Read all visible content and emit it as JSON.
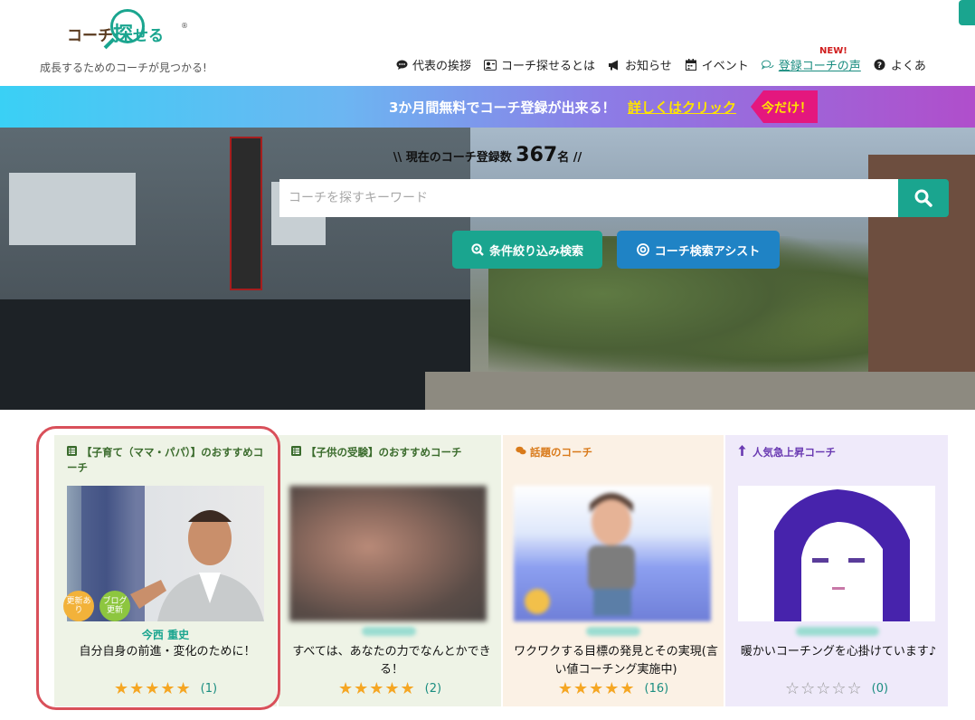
{
  "header": {
    "logo_left": "コーチ",
    "logo_mid": "探",
    "logo_end": "せる",
    "logo_reg": "®",
    "tagline": "成長するためのコーチが見つかる!",
    "new_badge": "NEW!",
    "nav": [
      {
        "label": "代表の挨拶",
        "icon": "chat-bubble-icon"
      },
      {
        "label": "コーチ探せるとは",
        "icon": "person-card-icon"
      },
      {
        "label": "お知らせ",
        "icon": "megaphone-icon"
      },
      {
        "label": "イベント",
        "icon": "calendar-icon"
      },
      {
        "label": "登録コーチの声",
        "icon": "comments-icon"
      },
      {
        "label": "よくあ",
        "icon": "question-circle-icon"
      }
    ]
  },
  "banner": {
    "text": "3か月間無料でコーチ登録が出来る！",
    "link": "詳しくはクリック",
    "tag": "今だけ！"
  },
  "hero": {
    "count_prefix": "\\\\ 現在のコーチ登録数",
    "count": "367",
    "count_suffix": "名 //",
    "search_placeholder": "コーチを探すキーワード",
    "filter_button": "条件絞り込み検索",
    "assist_button": "コーチ検索アシスト"
  },
  "cards": [
    {
      "title": "【子育て（ママ・パパ）】のおすすめコーチ",
      "name": "今西 重史",
      "desc": "自分自身の前進・変化のために！",
      "stars": "★★★★★",
      "count": "(1)",
      "badge1": "更新あり",
      "badge2": "ブログ更新"
    },
    {
      "title": "【子供の受験】のおすすめコーチ",
      "desc": "すべては、あなたの力でなんとかできる！",
      "stars": "★★★★★",
      "count": "(2)"
    },
    {
      "title": "話題のコーチ",
      "desc": "ワクワクする目標の発見とその実現(言い値コーチング実施中)",
      "stars": "★★★★★",
      "count": "(16)"
    },
    {
      "title": "人気急上昇コーチ",
      "desc": "暖かいコーチングを心掛けています♪",
      "stars": "☆☆☆☆☆",
      "count": "(0)"
    }
  ],
  "colors": {
    "accent": "#1aa58f",
    "blue": "#1f83c5",
    "banner_tag": "#e4177e",
    "star": "#f5a623",
    "highlight_outline": "#d9505a"
  }
}
